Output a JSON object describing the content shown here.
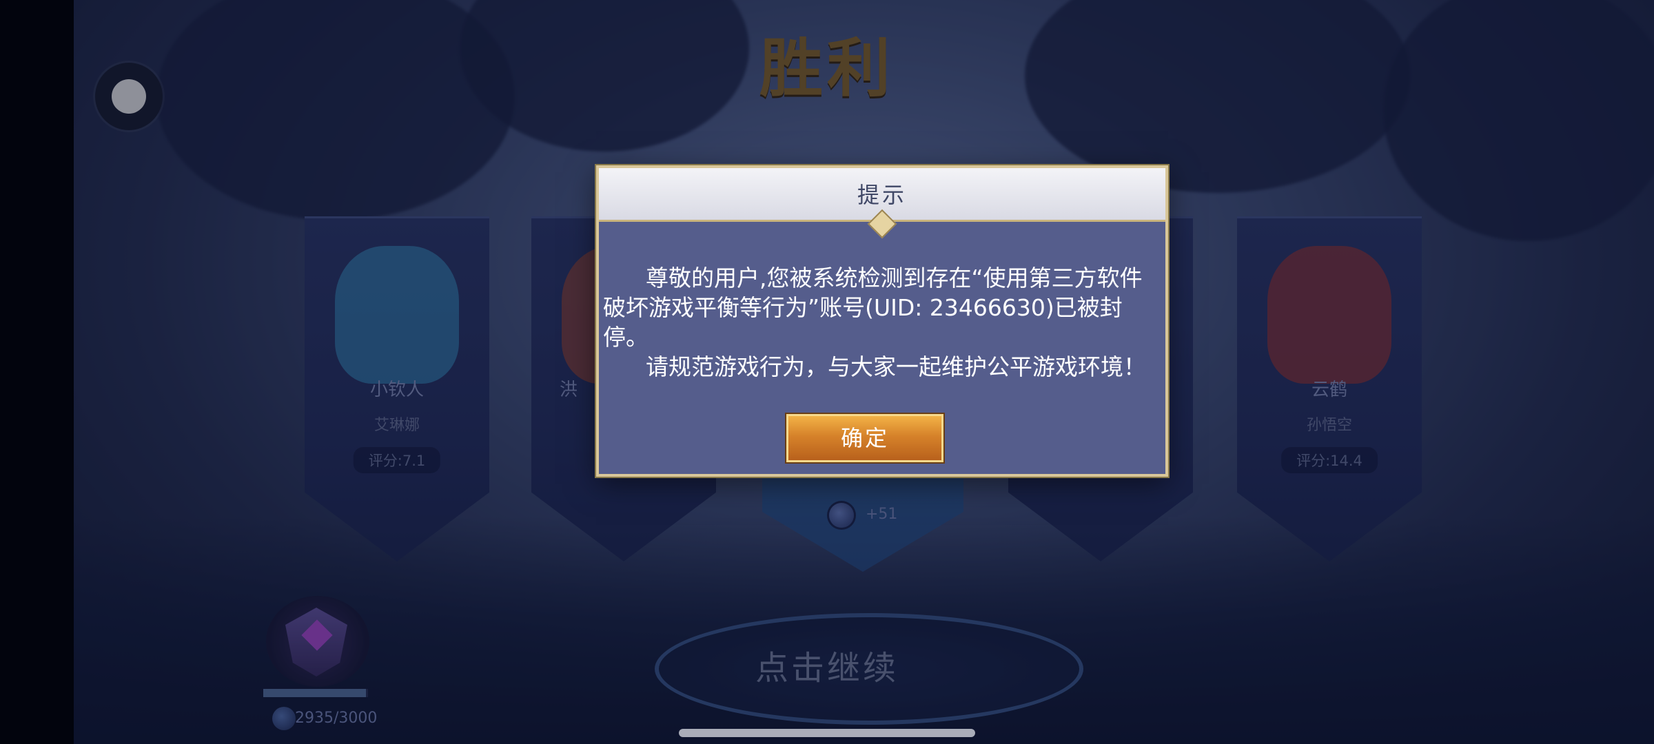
{
  "screen": {
    "victory_title": "胜利"
  },
  "heroes": [
    {
      "hero": "小钦人",
      "player": "艾琳娜",
      "score": "评分:7.1",
      "color": "#3fa8d8"
    },
    {
      "hero": "洪",
      "player": "",
      "score": "",
      "color": "#c0502c"
    },
    {
      "hero": "",
      "player": "",
      "score": "",
      "color": "#5a6aa0"
    },
    {
      "hero": "云鹤",
      "player": "孙悟空",
      "score": "评分:14.4",
      "color": "#c0392b"
    }
  ],
  "mvp": {
    "value": "+51"
  },
  "rank": {
    "points": "2935/3000",
    "progress": 0.978
  },
  "continue_label": "点击继续",
  "dialog": {
    "title": "提示",
    "message": "尊敬的用户,您被系统检测到存在“使用第三方软件破坏游戏平衡等行为”账号(UID: 23466630)已被封停。",
    "notice": "请规范游戏行为，与大家一起维护公平游戏环境！",
    "confirm_label": "确定"
  }
}
